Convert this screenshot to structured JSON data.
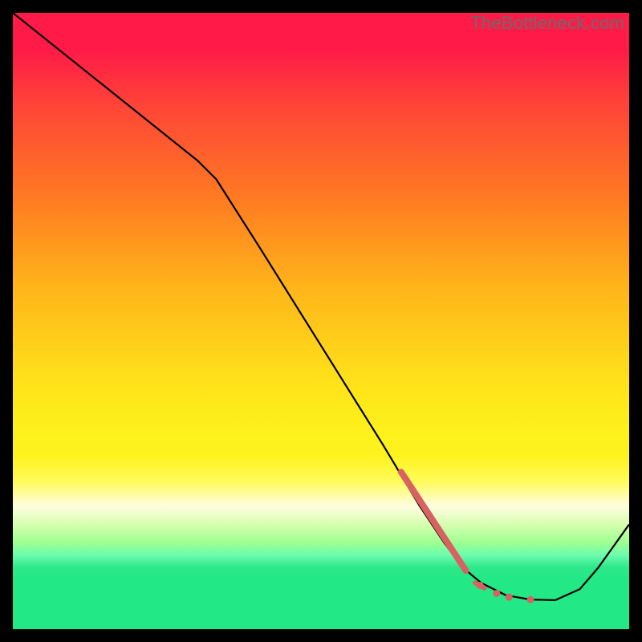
{
  "watermark": "TheBottleneck.com",
  "chart_data": {
    "type": "line",
    "title": "",
    "xlabel": "",
    "ylabel": "",
    "xlim": [
      0,
      100
    ],
    "ylim": [
      0,
      100
    ],
    "x": [
      0,
      5,
      10,
      15,
      20,
      25,
      30,
      33,
      40,
      50,
      60,
      66,
      70,
      73,
      76,
      80,
      84,
      88,
      92,
      95,
      100
    ],
    "y": [
      100,
      96,
      92,
      88,
      84,
      80,
      76,
      73,
      62,
      46,
      30,
      20,
      14,
      10,
      7.5,
      5.5,
      4.8,
      4.7,
      6.5,
      10,
      17
    ],
    "highlights": [
      {
        "type": "segment",
        "x0": 63,
        "y0": 25.5,
        "x1": 73.5,
        "y1": 9.5,
        "weight": 8
      },
      {
        "type": "segment",
        "x0": 75,
        "y0": 7.5,
        "x1": 76.5,
        "y1": 6.7,
        "weight": 6
      },
      {
        "type": "dot",
        "x": 75.8,
        "y": 7.1,
        "r": 4.5
      },
      {
        "type": "dot",
        "x": 78.5,
        "y": 5.8,
        "r": 4.5
      },
      {
        "type": "dot",
        "x": 80.5,
        "y": 5.2,
        "r": 4.5
      },
      {
        "type": "dot",
        "x": 84.0,
        "y": 4.8,
        "r": 4.5
      }
    ],
    "background_gradient": [
      {
        "stop": 0,
        "color": "#ff1a47"
      },
      {
        "stop": 50,
        "color": "#ffd21a"
      },
      {
        "stop": 80,
        "color": "#fffde0"
      },
      {
        "stop": 100,
        "color": "#22e886"
      }
    ]
  }
}
